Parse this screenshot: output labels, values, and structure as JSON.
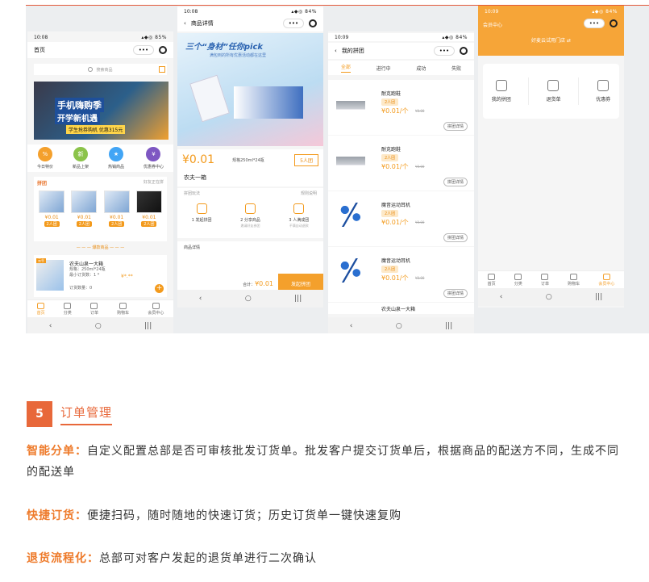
{
  "phone1": {
    "time": "10:08",
    "status": "85%",
    "title": "首页",
    "search_placeholder": "搜索商品",
    "banner_line1": "手机嗨购季",
    "banner_line2": "开学新机遇",
    "banner_line3": "学生抢券购机 优惠315元",
    "quick": [
      "今日特价",
      "新品上架",
      "热销商品",
      "优惠券中心"
    ],
    "group_title": "拼团",
    "group_more": "好友正在拼",
    "group_items": [
      {
        "price": "¥0.01",
        "badge": "2人团"
      },
      {
        "price": "¥0.01",
        "badge": "2人团"
      },
      {
        "price": "¥0.01",
        "badge": "2人团"
      },
      {
        "price": "¥0.01",
        "badge": "2人团"
      }
    ],
    "hot_title": "爆款商品",
    "product_badge": "云仓",
    "product_name": "农夫山泉一大箱",
    "product_spec": "规格：250ml*24瓶",
    "product_min": "最小订货数：1 *",
    "product_price": "¥*.**",
    "product_count": "订货数量：0",
    "tabs": [
      "首页",
      "分类",
      "订单",
      "购物车",
      "会员中心"
    ]
  },
  "phone2": {
    "time": "10:08",
    "status": "84%",
    "title": "商品详情",
    "banner_title": "三个“身材”任你pick",
    "banner_sub": "满包到的所有优惠活动都在这里",
    "price": "¥0.01",
    "spec": "规格250ml*24瓶",
    "group": "5人团",
    "name": "农夫一箱",
    "rule_label": "拼团玩法",
    "rule_link": "规则说明",
    "steps": [
      {
        "label": "1 发起拼团",
        "desc": ""
      },
      {
        "label": "2 分享商品",
        "desc": "邀请好友参团"
      },
      {
        "label": "3 人满成团",
        "desc": "不满自动退款"
      }
    ],
    "detail_label": "商品详情",
    "total_label": "合计：",
    "total_value": "¥0.01",
    "btn": "发起拼团"
  },
  "phone3": {
    "time": "10:09",
    "status": "84%",
    "title": "我的拼团",
    "tabs": [
      "全部",
      "进行中",
      "成功",
      "失败"
    ],
    "items": [
      {
        "name": "耐克跑鞋",
        "badge": "2人团",
        "price": "¥0.01/个",
        "old": "¥0.00",
        "btn": "拼团详情",
        "kind": "shoe"
      },
      {
        "name": "耐克跑鞋",
        "badge": "2人团",
        "price": "¥0.01/个",
        "old": "¥0.00",
        "btn": "拼团详情",
        "kind": "shoe"
      },
      {
        "name": "魔音运动耳机",
        "badge": "2人团",
        "price": "¥0.01/个",
        "old": "¥0.00",
        "btn": "拼团详情",
        "kind": "ear"
      },
      {
        "name": "魔音运动耳机",
        "badge": "2人团",
        "price": "¥0.01/个",
        "old": "¥0.00",
        "btn": "拼团详情",
        "kind": "ear"
      }
    ],
    "peek": "农夫山泉一大箱"
  },
  "phone4": {
    "time": "10:09",
    "status": "84%",
    "title": "会员中心",
    "store": "好麦云试用门店",
    "cards": [
      "我的拼团",
      "退货单",
      "优惠券"
    ],
    "tabs": [
      "首页",
      "分类",
      "订单",
      "购物车",
      "会员中心"
    ]
  },
  "section": {
    "number": "5",
    "title": "订单管理",
    "p1_key": "智能分单：",
    "p1_text": "自定义配置总部是否可审核批发订货单。批发客户提交订货单后，根据商品的配送方不同，生成不同的配送单",
    "p2_key": "快捷订货：",
    "p2_text": "便捷扫码，随时随地的快速订货；历史订货单一键快速复购",
    "p3_key": "退货流程化：",
    "p3_text": "总部可对客户发起的退货单进行二次确认"
  },
  "colors": {
    "accent": "#e8683a",
    "orange": "#f39a1c"
  }
}
